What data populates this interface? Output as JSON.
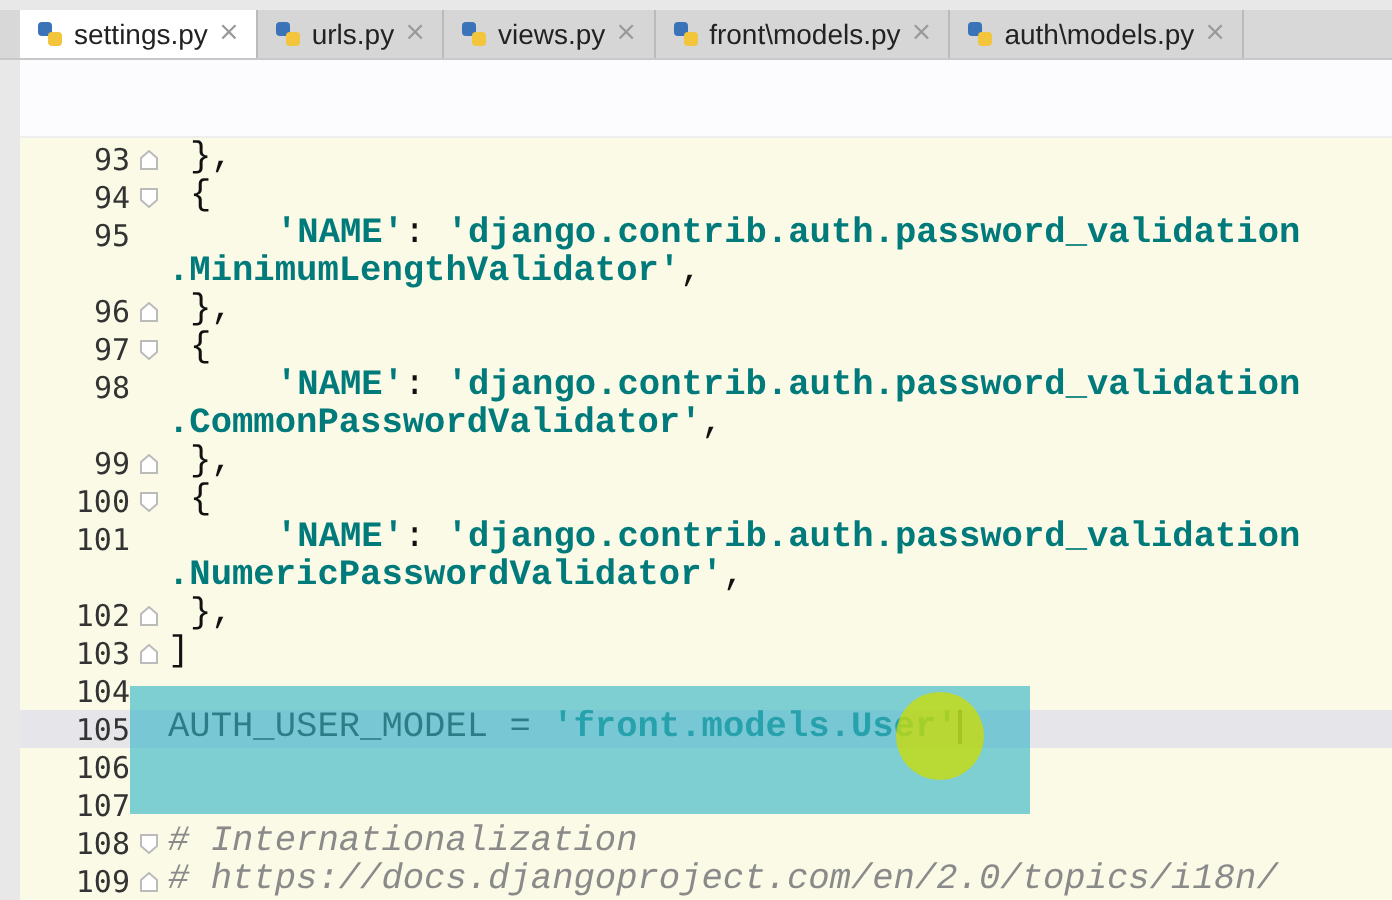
{
  "tabs": [
    {
      "label": "settings.py",
      "selected": true
    },
    {
      "label": "urls.py",
      "selected": false
    },
    {
      "label": "views.py",
      "selected": false
    },
    {
      "label": "front\\models.py",
      "selected": false
    },
    {
      "label": "auth\\models.py",
      "selected": false
    }
  ],
  "close_glyph": "×",
  "lines": [
    {
      "number": "93",
      "kind": "inner",
      "fold_start": false,
      "fold_end": true,
      "current": false,
      "segments": [
        {
          "kind": "plain",
          "text": "},"
        }
      ]
    },
    {
      "number": "94",
      "kind": "inner",
      "fold_start": true,
      "fold_end": false,
      "current": false,
      "segments": [
        {
          "kind": "plain",
          "text": "{"
        }
      ]
    },
    {
      "number": "95",
      "kind": "entry",
      "fold_start": false,
      "fold_end": false,
      "current": false,
      "segments": [
        {
          "kind": "string",
          "text": "'NAME'"
        },
        {
          "kind": "plain",
          "text": ": "
        },
        {
          "kind": "string",
          "text": "'django.contrib.auth.password_validation"
        }
      ]
    },
    {
      "kind": "top",
      "fold_start": false,
      "fold_end": false,
      "current": false,
      "segments": [
        {
          "kind": "string",
          "text": ".MinimumLengthValidator'"
        },
        {
          "kind": "plain",
          "text": ","
        }
      ]
    },
    {
      "number": "96",
      "kind": "inner",
      "fold_start": false,
      "fold_end": true,
      "current": false,
      "segments": [
        {
          "kind": "plain",
          "text": "},"
        }
      ]
    },
    {
      "number": "97",
      "kind": "inner",
      "fold_start": true,
      "fold_end": false,
      "current": false,
      "segments": [
        {
          "kind": "plain",
          "text": "{"
        }
      ]
    },
    {
      "number": "98",
      "kind": "entry",
      "fold_start": false,
      "fold_end": false,
      "current": false,
      "segments": [
        {
          "kind": "string",
          "text": "'NAME'"
        },
        {
          "kind": "plain",
          "text": ": "
        },
        {
          "kind": "string",
          "text": "'django.contrib.auth.password_validation"
        }
      ]
    },
    {
      "kind": "top",
      "fold_start": false,
      "fold_end": false,
      "current": false,
      "segments": [
        {
          "kind": "string",
          "text": ".CommonPasswordValidator'"
        },
        {
          "kind": "plain",
          "text": ","
        }
      ]
    },
    {
      "number": "99",
      "kind": "inner",
      "fold_start": false,
      "fold_end": true,
      "current": false,
      "segments": [
        {
          "kind": "plain",
          "text": "},"
        }
      ]
    },
    {
      "number": "100",
      "kind": "inner",
      "fold_start": true,
      "fold_end": false,
      "current": false,
      "segments": [
        {
          "kind": "plain",
          "text": "{"
        }
      ]
    },
    {
      "number": "101",
      "kind": "entry",
      "fold_start": false,
      "fold_end": false,
      "current": false,
      "segments": [
        {
          "kind": "string",
          "text": "'NAME'"
        },
        {
          "kind": "plain",
          "text": ": "
        },
        {
          "kind": "string",
          "text": "'django.contrib.auth.password_validation"
        }
      ]
    },
    {
      "kind": "top",
      "fold_start": false,
      "fold_end": false,
      "current": false,
      "segments": [
        {
          "kind": "string",
          "text": ".NumericPasswordValidator'"
        },
        {
          "kind": "plain",
          "text": ","
        }
      ]
    },
    {
      "number": "102",
      "kind": "inner",
      "fold_start": false,
      "fold_end": true,
      "current": false,
      "segments": [
        {
          "kind": "plain",
          "text": "},"
        }
      ]
    },
    {
      "number": "103",
      "kind": "top",
      "fold_start": false,
      "fold_end": true,
      "current": false,
      "segments": [
        {
          "kind": "plain",
          "text": "]"
        }
      ]
    },
    {
      "number": "104",
      "fold_start": false,
      "fold_end": false,
      "current": false
    },
    {
      "number": "105",
      "kind": "top",
      "fold_start": false,
      "fold_end": false,
      "current": true,
      "segments": [
        {
          "kind": "plain",
          "text": "AUTH_USER_MODEL = "
        },
        {
          "kind": "string",
          "text": "'front.models.User'"
        }
      ]
    },
    {
      "number": "106",
      "fold_start": false,
      "fold_end": false,
      "current": false
    },
    {
      "number": "107",
      "fold_start": false,
      "fold_end": false,
      "current": false
    },
    {
      "number": "108",
      "kind": "top",
      "fold_start": true,
      "fold_end": false,
      "current": false,
      "segments": [
        {
          "kind": "comment",
          "text": "# Internationalization"
        }
      ]
    },
    {
      "number": "109",
      "kind": "top",
      "fold_start": false,
      "fold_end": true,
      "current": false,
      "segments": [
        {
          "kind": "comment",
          "text": "# https://docs.djangoproject.com/en/2.0/topics/i18n/"
        }
      ]
    }
  ]
}
